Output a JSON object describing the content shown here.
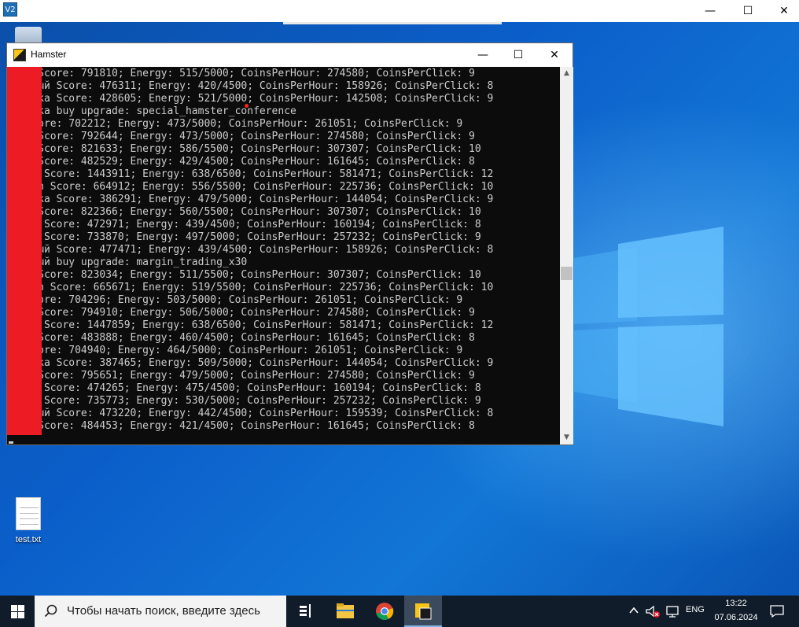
{
  "outer_window": {
    "app_icon_text": "V2",
    "minimize_glyph": "—",
    "maximize_glyph": "☐",
    "close_glyph": "✕"
  },
  "desktop": {
    "icons": [
      {
        "name": "recycle-bin",
        "label": ""
      },
      {
        "name": "test-txt",
        "label": "test.txt"
      }
    ]
  },
  "hamster_window": {
    "title": "Hamster",
    "minimize_glyph": "—",
    "maximize_glyph": "☐",
    "close_glyph": "✕",
    "console_lines": [
      "   d Score: 791810; Energy: 515/5000; CoinsPerHour: 274580; CoinsPerClick: 9",
      "   нный Score: 476311; Energy: 420/4500; CoinsPerHour: 158926; CoinsPerClick: 8",
      "   о4ка Score: 428605; Energy: 521/5000; CoinsPerHour: 142508; CoinsPerClick: 9",
      "   о4ка buy upgrade: special_hamster_conference",
      "   Score: 702212; Energy: 473/5000; CoinsPerHour: 261051; CoinsPerClick: 9",
      "   d Score: 792644; Energy: 473/5000; CoinsPerHour: 274580; CoinsPerClick: 9",
      "   s Score: 821633; Energy: 586/5500; CoinsPerHour: 307307; CoinsPerClick: 10",
      "   м Score: 482529; Energy: 429/4500; CoinsPerHour: 161645; CoinsPerClick: 8",
      "   ка Score: 1443911; Energy: 638/6500; CoinsPerHour: 581471; CoinsPerClick: 12",
      "   ach Score: 664912; Energy: 556/5500; CoinsPerHour: 225736; CoinsPerClick: 10",
      "   о4ка Score: 386291; Energy: 479/5000; CoinsPerHour: 144054; CoinsPerClick: 9",
      "   s Score: 822366; Energy: 560/5500; CoinsPerHour: 307307; CoinsPerClick: 10",
      "   ка Score: 472971; Energy: 439/4500; CoinsPerHour: 160194; CoinsPerClick: 8",
      "   ой Score: 733870; Energy: 497/5000; CoinsPerHour: 257232; CoinsPerClick: 9",
      "   нный Score: 477471; Energy: 439/4500; CoinsPerHour: 158926; CoinsPerClick: 8",
      "   нный buy upgrade: margin_trading_x30",
      "   s Score: 823034; Energy: 511/5500; CoinsPerHour: 307307; CoinsPerClick: 10",
      "   ach Score: 665671; Energy: 519/5500; CoinsPerHour: 225736; CoinsPerClick: 10",
      "   Score: 704296; Energy: 503/5000; CoinsPerHour: 261051; CoinsPerClick: 9",
      "   d Score: 794910; Energy: 506/5000; CoinsPerHour: 274580; CoinsPerClick: 9",
      "   ка Score: 1447859; Energy: 638/6500; CoinsPerHour: 581471; CoinsPerClick: 12",
      "   м Score: 483888; Energy: 460/4500; CoinsPerHour: 161645; CoinsPerClick: 8",
      "   Score: 704940; Energy: 464/5000; CoinsPerHour: 261051; CoinsPerClick: 9",
      "   о4ка Score: 387465; Energy: 509/5000; CoinsPerHour: 144054; CoinsPerClick: 9",
      "   d Score: 795651; Energy: 479/5000; CoinsPerHour: 274580; CoinsPerClick: 9",
      "   ка Score: 474265; Energy: 475/4500; CoinsPerHour: 160194; CoinsPerClick: 8",
      "   ой Score: 735773; Energy: 530/5000; CoinsPerHour: 257232; CoinsPerClick: 9",
      "   нный Score: 473220; Energy: 442/4500; CoinsPerHour: 159539; CoinsPerClick: 8",
      "   м Score: 484453; Energy: 421/4500; CoinsPerHour: 161645; CoinsPerClick: 8"
    ],
    "scrollbar": {
      "up_glyph": "▲",
      "down_glyph": "▼"
    }
  },
  "taskbar": {
    "search_placeholder": "Чтобы начать поиск, введите здесь",
    "language": "ENG",
    "time": "13:22",
    "date": "07.06.2024"
  },
  "colors": {
    "redaction": "#ed1c24",
    "console_bg": "#0c0c0c",
    "console_text": "#cccccc",
    "taskbar_bg": "#101c2a"
  }
}
